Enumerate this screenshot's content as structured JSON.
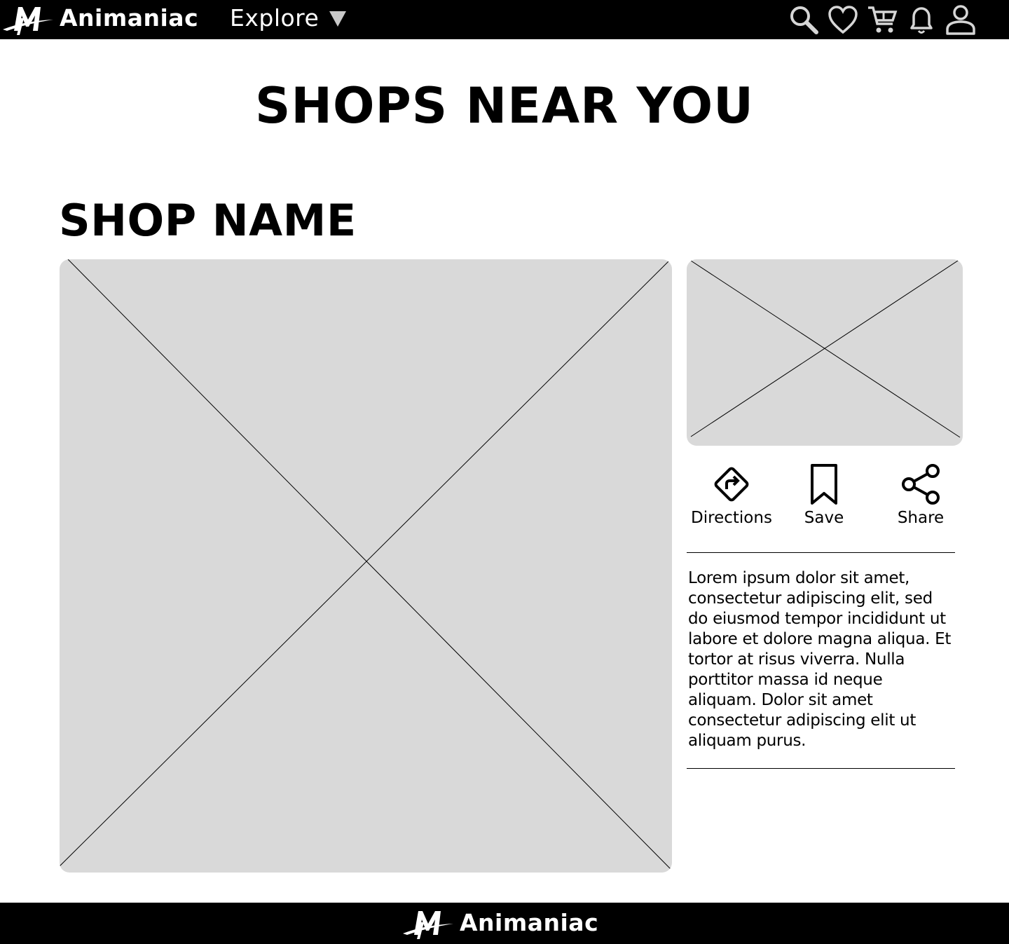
{
  "header": {
    "brand_name": "Animaniac",
    "explore_label": "Explore",
    "icons": [
      "search-icon",
      "heart-icon",
      "cart-icon",
      "bell-icon",
      "user-icon"
    ]
  },
  "page_title": "SHOPS NEAR YOU",
  "shop": {
    "name": "SHOP NAME",
    "actions": {
      "directions_label": "Directions",
      "save_label": "Save",
      "share_label": "Share"
    },
    "description": "Lorem ipsum dolor sit amet, consectetur adipiscing elit, sed do eiusmod tempor incididunt ut labore et dolore magna aliqua. Et tortor at risus viverra. Nulla porttitor massa id neque aliquam. Dolor sit amet consectetur adipiscing elit ut aliquam purus."
  },
  "footer": {
    "brand_name": "Animaniac"
  },
  "colors": {
    "bar_background": "#000000",
    "placeholder_fill": "#d9d9d9",
    "text": "#000000"
  }
}
